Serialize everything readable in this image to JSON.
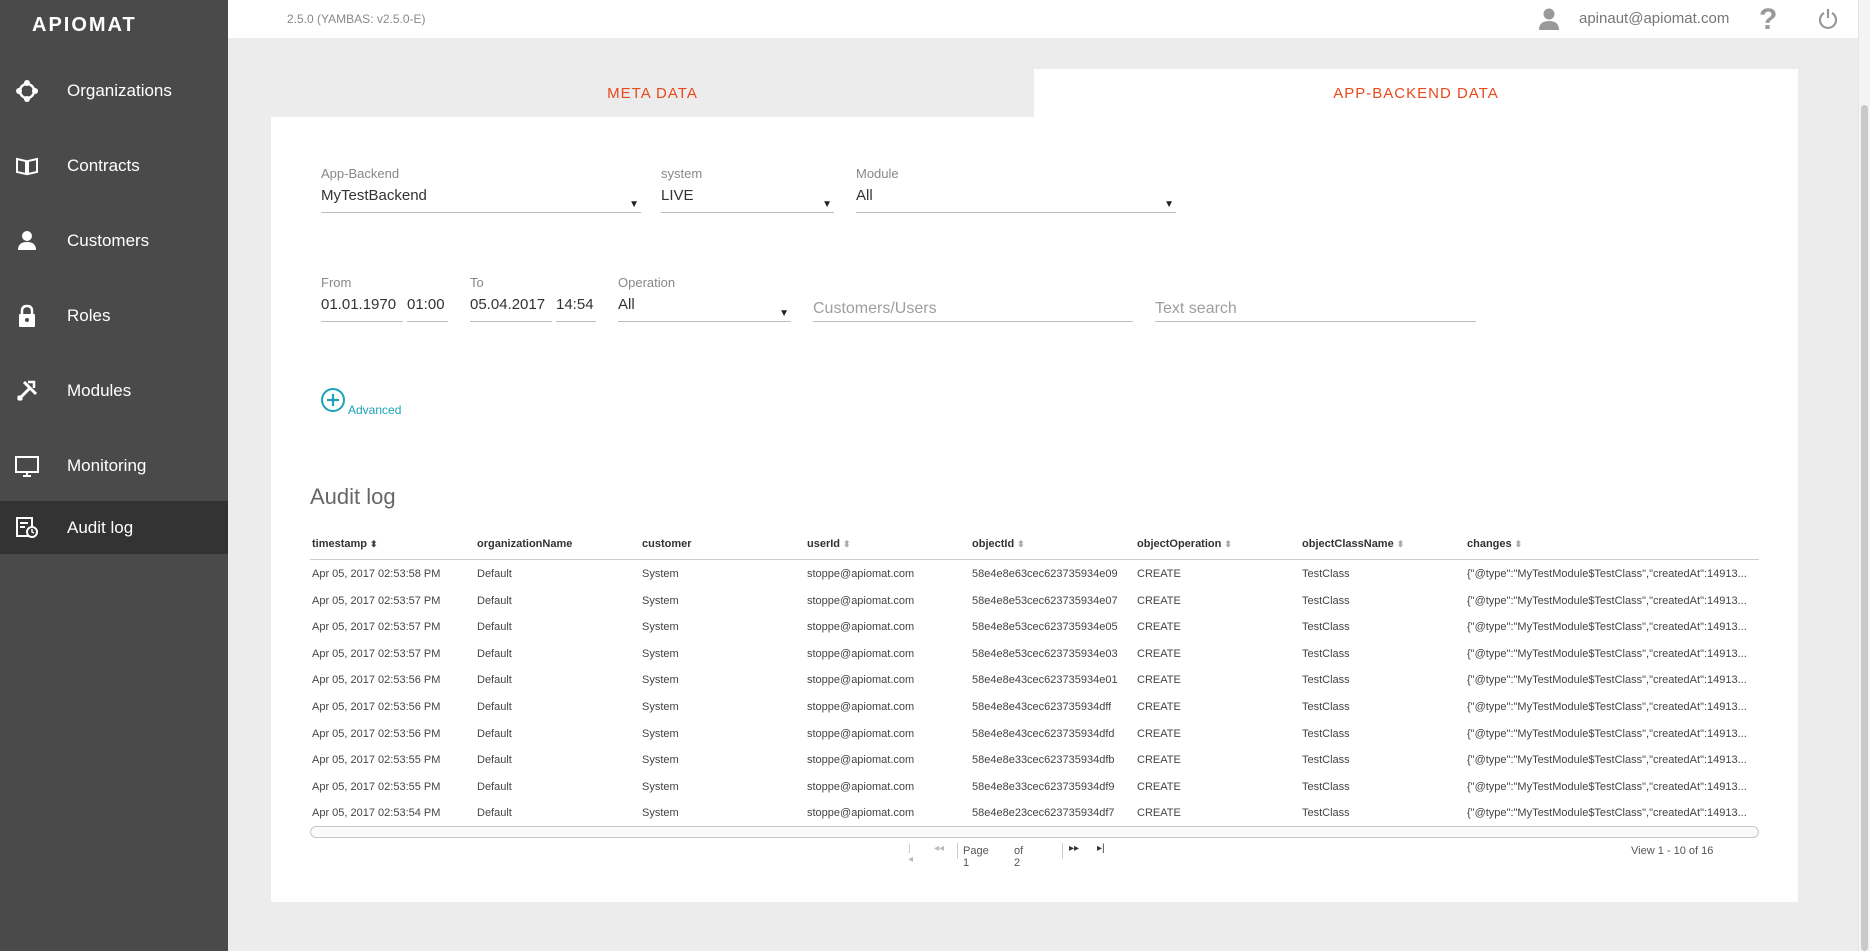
{
  "app": {
    "logo_text": "APIOMAT"
  },
  "sidebar": {
    "items": [
      {
        "label": "Organizations"
      },
      {
        "label": "Contracts"
      },
      {
        "label": "Customers"
      },
      {
        "label": "Roles"
      },
      {
        "label": "Modules"
      },
      {
        "label": "Monitoring"
      },
      {
        "label": "Audit log"
      }
    ]
  },
  "topbar": {
    "version": "2.5.0 (YAMBAS: v2.5.0-E)",
    "user_email": "apinaut@apiomat.com"
  },
  "tabs": [
    {
      "label": "META DATA",
      "active": false
    },
    {
      "label": "APP-BACKEND DATA",
      "active": true
    }
  ],
  "filters": {
    "app_backend": {
      "label": "App-Backend",
      "value": "MyTestBackend"
    },
    "system": {
      "label": "system",
      "value": "LIVE"
    },
    "module": {
      "label": "Module",
      "value": "All"
    },
    "from": {
      "label": "From",
      "date": "01.01.1970",
      "time": "01:00"
    },
    "to": {
      "label": "To",
      "date": "05.04.2017",
      "time": "14:54"
    },
    "operation": {
      "label": "Operation",
      "value": "All"
    },
    "customers_users": {
      "placeholder": "Customers/Users"
    },
    "text_search": {
      "placeholder": "Text search"
    },
    "advanced_label": "Advanced"
  },
  "audit": {
    "title": "Audit log",
    "columns": [
      "timestamp",
      "organizationName",
      "customer",
      "userId",
      "objectId",
      "objectOperation",
      "objectClassName",
      "changes"
    ],
    "rows": [
      [
        "Apr 05, 2017 02:53:58 PM",
        "Default",
        "System",
        "stoppe@apiomat.com",
        "58e4e8e63cec623735934e09",
        "CREATE",
        "TestClass",
        "{\"@type\":\"MyTestModule$TestClass\",\"createdAt\":14913..."
      ],
      [
        "Apr 05, 2017 02:53:57 PM",
        "Default",
        "System",
        "stoppe@apiomat.com",
        "58e4e8e53cec623735934e07",
        "CREATE",
        "TestClass",
        "{\"@type\":\"MyTestModule$TestClass\",\"createdAt\":14913..."
      ],
      [
        "Apr 05, 2017 02:53:57 PM",
        "Default",
        "System",
        "stoppe@apiomat.com",
        "58e4e8e53cec623735934e05",
        "CREATE",
        "TestClass",
        "{\"@type\":\"MyTestModule$TestClass\",\"createdAt\":14913..."
      ],
      [
        "Apr 05, 2017 02:53:57 PM",
        "Default",
        "System",
        "stoppe@apiomat.com",
        "58e4e8e53cec623735934e03",
        "CREATE",
        "TestClass",
        "{\"@type\":\"MyTestModule$TestClass\",\"createdAt\":14913..."
      ],
      [
        "Apr 05, 2017 02:53:56 PM",
        "Default",
        "System",
        "stoppe@apiomat.com",
        "58e4e8e43cec623735934e01",
        "CREATE",
        "TestClass",
        "{\"@type\":\"MyTestModule$TestClass\",\"createdAt\":14913..."
      ],
      [
        "Apr 05, 2017 02:53:56 PM",
        "Default",
        "System",
        "stoppe@apiomat.com",
        "58e4e8e43cec623735934dff",
        "CREATE",
        "TestClass",
        "{\"@type\":\"MyTestModule$TestClass\",\"createdAt\":14913..."
      ],
      [
        "Apr 05, 2017 02:53:56 PM",
        "Default",
        "System",
        "stoppe@apiomat.com",
        "58e4e8e43cec623735934dfd",
        "CREATE",
        "TestClass",
        "{\"@type\":\"MyTestModule$TestClass\",\"createdAt\":14913..."
      ],
      [
        "Apr 05, 2017 02:53:55 PM",
        "Default",
        "System",
        "stoppe@apiomat.com",
        "58e4e8e33cec623735934dfb",
        "CREATE",
        "TestClass",
        "{\"@type\":\"MyTestModule$TestClass\",\"createdAt\":14913..."
      ],
      [
        "Apr 05, 2017 02:53:55 PM",
        "Default",
        "System",
        "stoppe@apiomat.com",
        "58e4e8e33cec623735934df9",
        "CREATE",
        "TestClass",
        "{\"@type\":\"MyTestModule$TestClass\",\"createdAt\":14913..."
      ],
      [
        "Apr 05, 2017 02:53:54 PM",
        "Default",
        "System",
        "stoppe@apiomat.com",
        "58e4e8e23cec623735934df7",
        "CREATE",
        "TestClass",
        "{\"@type\":\"MyTestModule$TestClass\",\"createdAt\":14913..."
      ]
    ]
  },
  "pager": {
    "page_label": "Page 1",
    "of_label": "of 2",
    "view_info": "View 1 - 10 of 16"
  },
  "colors": {
    "accent": "#e8491d",
    "link": "#1aa3b5",
    "sidebar": "#4a4a4a",
    "sidebar_active": "#333333"
  },
  "icons": [
    "organizations-icon",
    "contracts-icon",
    "customers-icon",
    "roles-icon",
    "modules-icon",
    "monitoring-icon",
    "audit-log-icon",
    "user-icon",
    "help-icon",
    "power-icon",
    "add-circle-icon"
  ]
}
